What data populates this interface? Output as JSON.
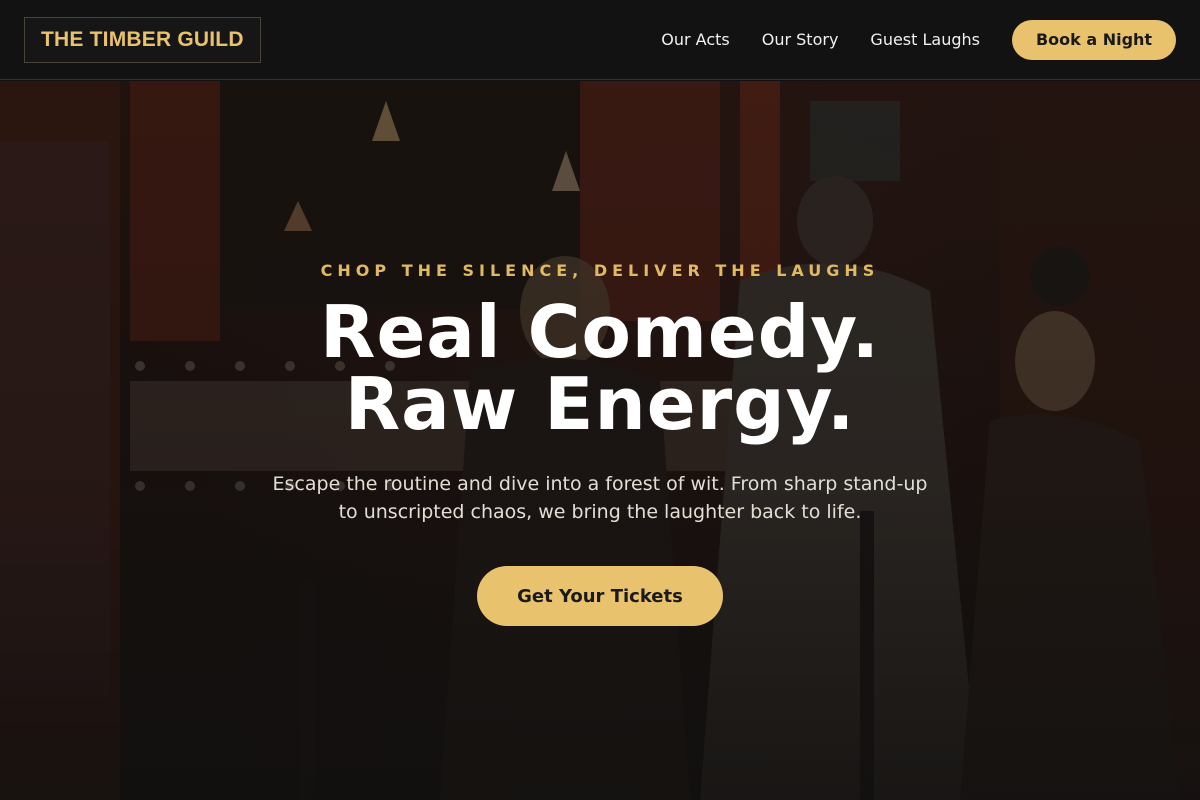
{
  "header": {
    "logo": "THE TIMBER GUILD",
    "nav": [
      {
        "label": "Our Acts"
      },
      {
        "label": "Our Story"
      },
      {
        "label": "Guest Laughs"
      }
    ],
    "book_label": "Book a Night"
  },
  "hero": {
    "tagline": "CHOP THE SILENCE, DELIVER THE LAUGHS",
    "headline_line1": "Real Comedy.",
    "headline_line2": "Raw Energy.",
    "subtext": "Escape the routine and dive into a forest of wit. From sharp stand-up to unscripted chaos, we bring the laughter back to life.",
    "cta_label": "Get Your Tickets",
    "background_image": "comedy-club-crowd-photo"
  },
  "colors": {
    "accent": "#e8c26c",
    "header_bg": "#121212",
    "text_light": "#ffffff"
  }
}
